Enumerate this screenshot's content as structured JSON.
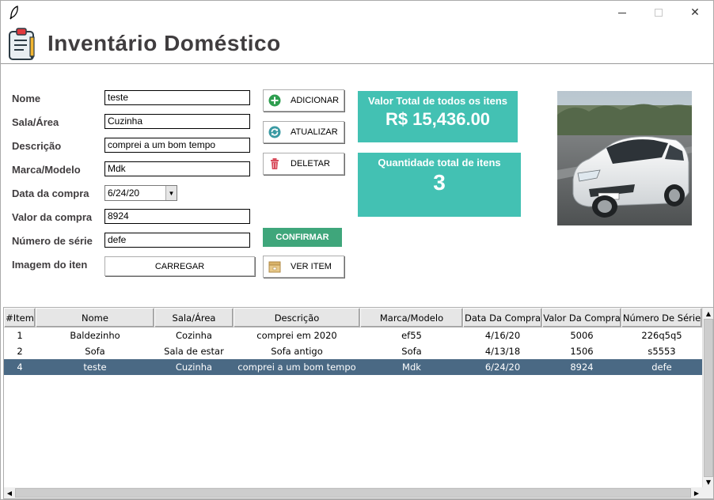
{
  "window": {
    "minimize_glyph": "",
    "close_glyph": "✕"
  },
  "header": {
    "title": "Inventário Doméstico",
    "icon": "clipboard-icon"
  },
  "form": {
    "fields": {
      "nome": {
        "label": "Nome",
        "value": "teste"
      },
      "sala": {
        "label": "Sala/Área",
        "value": "Cuzinha"
      },
      "descricao": {
        "label": "Descrição",
        "value": "comprei a um bom tempo"
      },
      "marca": {
        "label": "Marca/Modelo",
        "value": "Mdk"
      },
      "data": {
        "label": "Data da compra",
        "value": "6/24/20"
      },
      "valor": {
        "label": "Valor da compra",
        "value": "8924"
      },
      "serie": {
        "label": "Número de série",
        "value": "defe"
      },
      "imagem": {
        "label": "Imagem do iten"
      }
    },
    "load_button": "CARREGAR"
  },
  "actions": {
    "add": {
      "label": "ADICIONAR",
      "icon": "plus-circle-icon",
      "color": "#2e9e4f"
    },
    "update": {
      "label": "ATUALIZAR",
      "icon": "refresh-icon",
      "color": "#3a9aa3"
    },
    "delete": {
      "label": "DELETAR",
      "icon": "trash-icon",
      "color": "#d84c5c"
    },
    "confirm": {
      "label": "CONFIRMAR",
      "color": "#3fa67b"
    },
    "view": {
      "label": "VER ITEM",
      "icon": "box-icon"
    }
  },
  "stats": {
    "total_value_label": "Valor Total de todos os itens",
    "total_value": "R$ 15,436.00",
    "total_qty_label": "Quantidade total de itens",
    "total_qty": "3",
    "color": "#43c1b3"
  },
  "table": {
    "columns": [
      "#Item",
      "Nome",
      "Sala/Área",
      "Descrição",
      "Marca/Modelo",
      "Data Da Compra",
      "Valor Da Compra",
      "Número De Série"
    ],
    "rows": [
      [
        "1",
        "Baldezinho",
        "Cozinha",
        "comprei em 2020",
        "ef55",
        "4/16/20",
        "5006",
        "226q5q5"
      ],
      [
        "2",
        "Sofa",
        "Sala de estar",
        "Sofa antigo",
        "Sofa",
        "4/13/18",
        "1506",
        "s5553"
      ],
      [
        "4",
        "teste",
        "Cuzinha",
        "comprei a um bom tempo",
        "Mdk",
        "6/24/20",
        "8924",
        "defe"
      ]
    ],
    "selected_color": "#4a6984"
  }
}
